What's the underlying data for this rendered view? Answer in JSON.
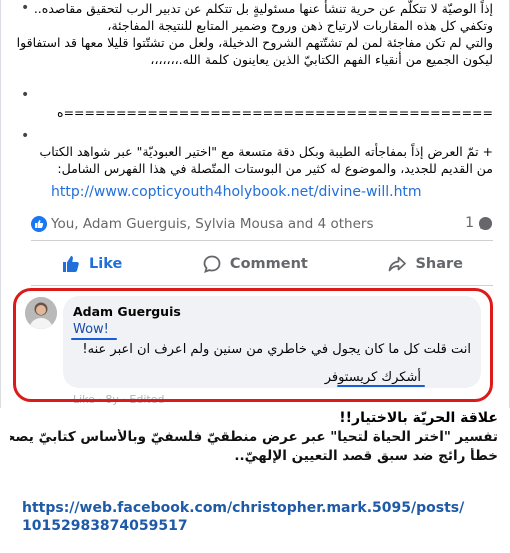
{
  "post": {
    "lines": [
      "إذاً الوصيّة لا تتكلّم عن حرية تنشأ عنها مسئوليةٍ بل تتكلم عن تدبير الرب لتحقيق مقاصده..",
      "وتكفي كل هذه المقاربات لارتياح ذهن وروح وضمير المتابع للنتيجة المفاجئة،",
      "والتي لم تكن مفاجئة لمن لم تشتّتهم الشروح الدخيلة، ولعل من تشتّتوا قليلا معها قد استفاقوا الآن",
      "ليكون الجميع من أنقياء الفهم الكتابيّ الذين يعاينون كلمة الله.،،،،،،،"
    ],
    "separator": "=========================================ه",
    "lines2": [
      "+ تمّ العرض إذاً بمفاجأته الطيبة وبكل دقة متسعة مع \"اختير العبوديّة\" عبر شواهد الكتاب",
      "من القديم للجديد، والموضوع له كثير من البوستات المتّصلة في هذا الفهرس الشامل:"
    ],
    "link": "http://www.copticyouth4holybook.net/divine-will.htm",
    "reactions_text": "You, Adam Guerguis, Sylvia Mousa and 4 others",
    "comment_count": "1",
    "actions": {
      "like": "Like",
      "comment": "Comment",
      "share": "Share"
    },
    "colors": {
      "accent": "#216fdb",
      "highlight_border": "#dd1a1a"
    }
  },
  "comment": {
    "author": "Adam Guerguis",
    "wow": "Wow!",
    "line1": "انت قلت كل ما كان يجول في خاطري من سنين ولم اعرف ان اعبر عنه!",
    "line2": "أشكرك كريستوفر",
    "meta": "Like · 8y · Edited"
  },
  "caption": {
    "title": "علاقة الحريّة بالاختيار!!",
    "p1": "تفسير \"اختر الحياة لتحيا\" عبر عرض منطقيّ فلسفيّ وبالأساس كتابيّ يصحح",
    "p2": "خطأً رائج ضد سبق قصد التعيين الإلهيّ.."
  },
  "source": {
    "url_line1": "https://web.facebook.com/christopher.mark.5095/posts/",
    "url_line2": "10152983874059517"
  }
}
